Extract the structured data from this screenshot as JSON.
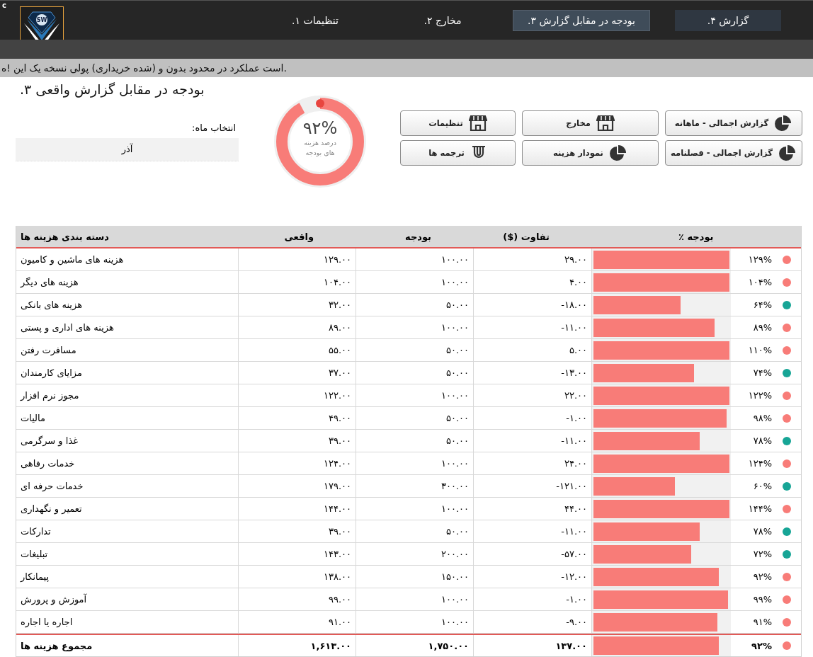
{
  "corner_mark": "c",
  "logo": {
    "text": "SW"
  },
  "tabs": [
    {
      "label": "گزارش ۴.",
      "selected": false,
      "kind": "box"
    },
    {
      "label": "بودجه در مقابل گزارش ۳.",
      "selected": true,
      "kind": "box"
    },
    {
      "label": "مخارج ۲.",
      "selected": false,
      "kind": "text"
    },
    {
      "label": "تنظیمات ۱.",
      "selected": false,
      "kind": "text"
    }
  ],
  "banner": "ه! این یک نسخه پولی (خریداری شده) و بدون محدود در عملکرد است.",
  "title": "بودجه در مقابل گزارش واقعی ۳.",
  "month_select": {
    "label": "انتخاب ماه:",
    "value": "آذر"
  },
  "gauge": {
    "reading": "۹۲%",
    "caption_1": "درصد هزینه",
    "caption_2": "های بودجه",
    "level": 0.92
  },
  "buttons": [
    {
      "label": "گزارش اجمالی - ماهانه",
      "kind": "pie"
    },
    {
      "label": "مخارج",
      "kind": "store"
    },
    {
      "label": "تنظیمات",
      "kind": "store"
    },
    {
      "label": "گزارش اجمالی - فصلنامه",
      "kind": "pie"
    },
    {
      "label": "نمودار هزینه",
      "kind": "pie"
    },
    {
      "label": "ترجمه ها",
      "kind": "cup"
    }
  ],
  "table": {
    "columns": [
      "بودجه ٪",
      "تفاوت ($)",
      "بودجه",
      "واقعی",
      "دسته بندی هزینه ها"
    ],
    "rows": [
      {
        "category": "هزینه های ماشین و کامیون",
        "actual": "۱۲۹.۰۰",
        "budget": "۱۰۰.۰۰",
        "variance": "۲۹.۰۰",
        "level": 1,
        "percent": "۱۲۹%",
        "color": "#f87c78"
      },
      {
        "category": "هزینه های دیگر",
        "actual": "۱۰۴.۰۰",
        "budget": "۱۰۰.۰۰",
        "variance": "۴.۰۰",
        "level": 1,
        "percent": "۱۰۴%",
        "color": "#f87c78"
      },
      {
        "category": "هزینه های بانکی",
        "actual": "۳۲.۰۰",
        "budget": "۵۰.۰۰",
        "variance": "-۱۸.۰۰",
        "level": 0.64,
        "percent": "۶۴%",
        "color": "#17a596"
      },
      {
        "category": "هزینه های اداری و پستی",
        "actual": "۸۹.۰۰",
        "budget": "۱۰۰.۰۰",
        "variance": "-۱۱.۰۰",
        "level": 0.89,
        "percent": "۸۹%",
        "color": "#f87c78"
      },
      {
        "category": "مسافرت رفتن",
        "actual": "۵۵.۰۰",
        "budget": "۵۰.۰۰",
        "variance": "۵.۰۰",
        "level": 1,
        "percent": "۱۱۰%",
        "color": "#f87c78"
      },
      {
        "category": "مزایای کارمندان",
        "actual": "۳۷.۰۰",
        "budget": "۵۰.۰۰",
        "variance": "-۱۳.۰۰",
        "level": 0.74,
        "percent": "۷۴%",
        "color": "#17a596"
      },
      {
        "category": "مجوز نرم افزار",
        "actual": "۱۲۲.۰۰",
        "budget": "۱۰۰.۰۰",
        "variance": "۲۲.۰۰",
        "level": 1,
        "percent": "۱۲۲%",
        "color": "#f87c78"
      },
      {
        "category": "مالیات",
        "actual": "۴۹.۰۰",
        "budget": "۵۰.۰۰",
        "variance": "-۱.۰۰",
        "level": 0.98,
        "percent": "۹۸%",
        "color": "#f87c78"
      },
      {
        "category": "غذا و سرگرمی",
        "actual": "۳۹.۰۰",
        "budget": "۵۰.۰۰",
        "variance": "-۱۱.۰۰",
        "level": 0.78,
        "percent": "۷۸%",
        "color": "#17a596"
      },
      {
        "category": "خدمات رفاهی",
        "actual": "۱۲۴.۰۰",
        "budget": "۱۰۰.۰۰",
        "variance": "۲۴.۰۰",
        "level": 1,
        "percent": "۱۲۴%",
        "color": "#f87c78"
      },
      {
        "category": "خدمات حرفه ای",
        "actual": "۱۷۹.۰۰",
        "budget": "۳۰۰.۰۰",
        "variance": "-۱۲۱.۰۰",
        "level": 0.6,
        "percent": "۶۰%",
        "color": "#17a596"
      },
      {
        "category": "تعمیر و نگهداری",
        "actual": "۱۴۴.۰۰",
        "budget": "۱۰۰.۰۰",
        "variance": "۴۴.۰۰",
        "level": 1,
        "percent": "۱۴۴%",
        "color": "#f87c78"
      },
      {
        "category": "تدارکات",
        "actual": "۳۹.۰۰",
        "budget": "۵۰.۰۰",
        "variance": "-۱۱.۰۰",
        "level": 0.78,
        "percent": "۷۸%",
        "color": "#17a596"
      },
      {
        "category": "تبلیغات",
        "actual": "۱۴۳.۰۰",
        "budget": "۲۰۰.۰۰",
        "variance": "-۵۷.۰۰",
        "level": 0.72,
        "percent": "۷۲%",
        "color": "#17a596"
      },
      {
        "category": "پیمانکار",
        "actual": "۱۳۸.۰۰",
        "budget": "۱۵۰.۰۰",
        "variance": "-۱۲.۰۰",
        "level": 0.92,
        "percent": "۹۲%",
        "color": "#f87c78"
      },
      {
        "category": "آموزش و پرورش",
        "actual": "۹۹.۰۰",
        "budget": "۱۰۰.۰۰",
        "variance": "-۱.۰۰",
        "level": 0.99,
        "percent": "۹۹%",
        "color": "#f87c78"
      },
      {
        "category": "اجاره یا اجاره",
        "actual": "۹۱.۰۰",
        "budget": "۱۰۰.۰۰",
        "variance": "-۹.۰۰",
        "level": 0.91,
        "percent": "۹۱%",
        "color": "#f87c78"
      }
    ],
    "total": {
      "category": "مجموع هزینه ها",
      "actual": "۱,۶۱۳.۰۰",
      "budget": "۱,۷۵۰.۰۰",
      "variance": "۱۳۷.۰۰",
      "level": 0.92,
      "percent": "۹۲%",
      "color": "#f87c78"
    }
  }
}
